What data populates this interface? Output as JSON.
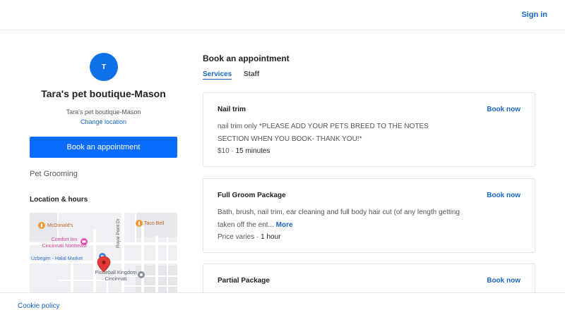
{
  "header": {
    "signin_label": "Sign in"
  },
  "business": {
    "avatar_letter": "T",
    "title": "Tara's pet boutique-Mason",
    "location_name": "Tara's pet boutique-Mason",
    "change_location_label": "Change location",
    "book_button_label": "Book an appointment",
    "category": "Pet Grooming",
    "location_hours_title": "Location & hours"
  },
  "map": {
    "streets": [
      "Royal Point Dr"
    ],
    "places": [
      {
        "name": "McDonald's",
        "icon": "restaurant-icon"
      },
      {
        "name": "Taco Bell",
        "icon": "restaurant-icon"
      },
      {
        "name": "Comfort Inn Cincinnati Northeast",
        "lines": [
          "Comfort Inn",
          "Cincinnati Northeast"
        ],
        "icon": "hotel-icon"
      },
      {
        "name": "Uzbegim - Halal Market",
        "icon": "shopping-icon"
      },
      {
        "name": "Pickleball Kingdom Cincinnati",
        "lines": [
          "Pickleball Kingdom",
          "Cincinnati"
        ],
        "icon": "place-icon"
      }
    ]
  },
  "booking": {
    "title": "Book an appointment",
    "tabs": {
      "services": "Services",
      "staff": "Staff"
    },
    "services": [
      {
        "name": "Nail trim",
        "book_label": "Book now",
        "description": "nail trim only *PLEASE ADD YOUR PETS BREED TO THE NOTES SECTION WHEN YOU BOOK- THANK YOU!*",
        "price": "$10",
        "duration": "15 minutes"
      },
      {
        "name": "Full Groom Package",
        "book_label": "Book now",
        "description": "Bath, brush, nail trim, ear cleaning and full body hair cut (of any length getting taken off the ent...",
        "more_label": "More",
        "price": "Price varies",
        "duration": "1 hour"
      },
      {
        "name": "Partial Package",
        "book_label": "Book now"
      }
    ]
  },
  "footer": {
    "cookie_policy_label": "Cookie policy"
  },
  "colors": {
    "link": "#1a66c7",
    "primary_button": "#0a6cff",
    "avatar": "#0e71e8",
    "map_pin": "#e53935"
  }
}
